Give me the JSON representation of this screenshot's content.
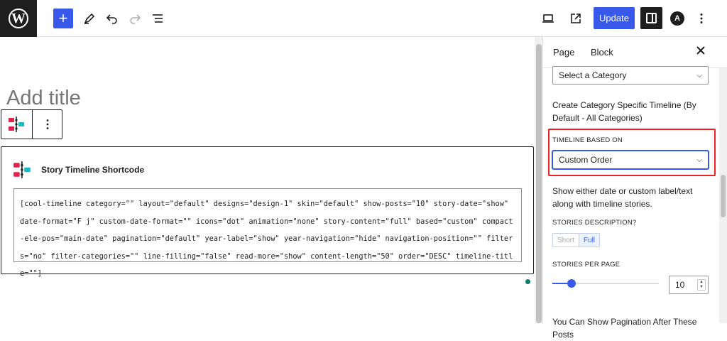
{
  "toolbar": {
    "logo_icon": "wordpress-logo-icon",
    "add_label": "+",
    "update_label": "Update",
    "astra_label": "A"
  },
  "editor": {
    "title_placeholder": "Add title",
    "block": {
      "title": "Story Timeline Shortcode",
      "shortcode": "[cool-timeline category=\"\" layout=\"default\" designs=\"design-1\" skin=\"default\" show-posts=\"10\" story-date=\"show\" date-format=\"F j\" custom-date-format=\"\" icons=\"dot\" animation=\"none\" story-content=\"full\" based=\"custom\" compact-ele-pos=\"main-date\" pagination=\"default\" year-label=\"show\" year-navigation=\"hide\" navigation-position=\"\" filters=\"no\" filter-categories=\"\" line-filling=\"false\" read-more=\"show\" content-length=\"50\" order=\"DESC\" timeline-title=\"\"]"
    }
  },
  "sidebar": {
    "tabs": [
      {
        "label": "Page"
      },
      {
        "label": "Block"
      }
    ],
    "active_tab": "Block",
    "category_select": "Select a Category",
    "category_help": "Create Category Specific Timeline (By Default - All Categories)",
    "timeline_based_label": "TIMELINE BASED ON",
    "timeline_based_value": "Custom Order",
    "timeline_based_help": "Show either date or custom label/text along with timeline stories.",
    "stories_description_label": "STORIES DESCRIPTION?",
    "stories_description_options": [
      "Short",
      "Full"
    ],
    "stories_description_selected": "Full",
    "stories_per_page_label": "STORIES PER PAGE",
    "stories_per_page_value": "10",
    "stories_per_page_fraction": 0.18,
    "bottom_text": "You Can Show Pagination After These Posts"
  },
  "colors": {
    "accent": "#3858e9",
    "highlight_border": "#ee2222",
    "dark": "#1e1e1e"
  }
}
